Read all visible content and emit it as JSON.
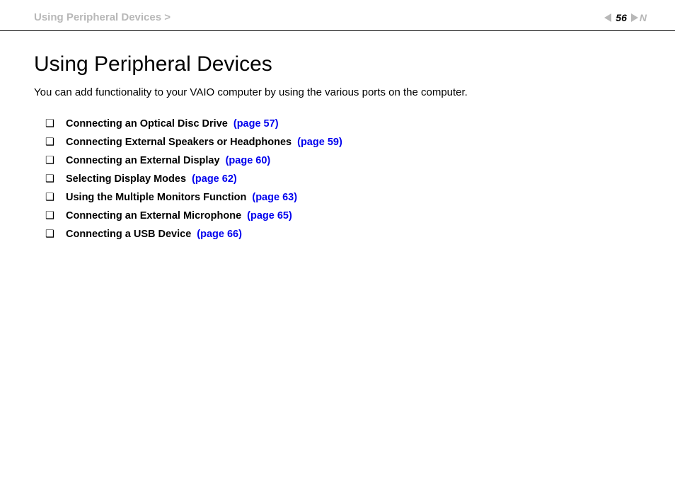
{
  "header": {
    "breadcrumb": "Using Peripheral Devices >",
    "page_number": "56",
    "nav_letter": "N"
  },
  "content": {
    "title": "Using Peripheral Devices",
    "intro": "You can add functionality to your VAIO computer by using the various ports on the computer."
  },
  "items": [
    {
      "label": "Connecting an Optical Disc Drive",
      "page_link": "(page 57)"
    },
    {
      "label": "Connecting External Speakers or Headphones",
      "page_link": "(page 59)"
    },
    {
      "label": "Connecting an External Display",
      "page_link": "(page 60)"
    },
    {
      "label": "Selecting Display Modes",
      "page_link": "(page 62)"
    },
    {
      "label": "Using the Multiple Monitors Function",
      "page_link": "(page 63)"
    },
    {
      "label": "Connecting an External Microphone",
      "page_link": "(page 65)"
    },
    {
      "label": "Connecting a USB Device",
      "page_link": "(page 66)"
    }
  ]
}
